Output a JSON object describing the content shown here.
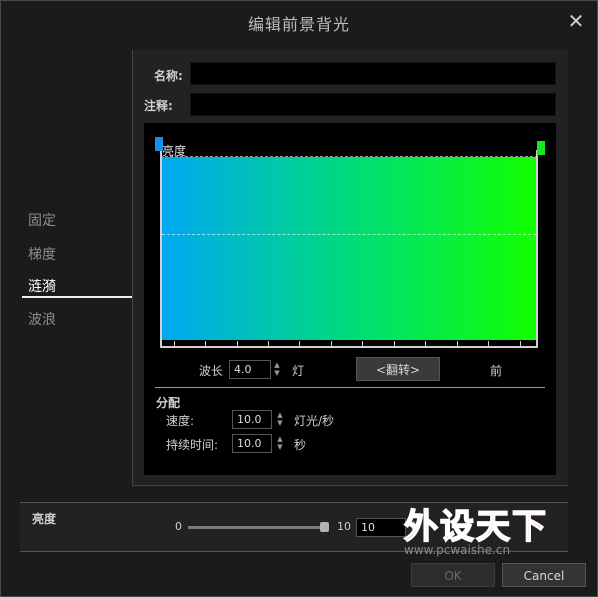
{
  "window": {
    "title": "编辑前景背光",
    "close_icon": "close-icon"
  },
  "nav": {
    "items": [
      {
        "label": "固定",
        "active": false
      },
      {
        "label": "梯度",
        "active": false
      },
      {
        "label": "涟漪",
        "active": true
      },
      {
        "label": "波浪",
        "active": false
      }
    ]
  },
  "fields": {
    "name_label": "名称:",
    "name_value": "",
    "note_label": "注释:",
    "note_value": ""
  },
  "editor": {
    "brightness_label": "亮度",
    "gradient_start_color": "#00a8f2",
    "gradient_end_color": "#12ff00",
    "wavelength_label": "波长",
    "wavelength_value": "4.0",
    "wavelength_unit": "灯",
    "flip_button": "<翻转>",
    "direction_label": "前"
  },
  "distribution": {
    "heading": "分配",
    "speed_label": "速度:",
    "speed_value": "10.0",
    "speed_unit": "灯光/秒",
    "duration_label": "持续时间:",
    "duration_value": "10.0",
    "duration_unit": "秒"
  },
  "brightness_panel": {
    "label": "亮度",
    "min": "0",
    "max": "10",
    "value": "10",
    "level_fraction": 1.0
  },
  "footer": {
    "ok_label": "OK",
    "cancel_label": "Cancel"
  },
  "watermark": {
    "text": "外设天下",
    "url": "www.pcwaishe.cn"
  }
}
